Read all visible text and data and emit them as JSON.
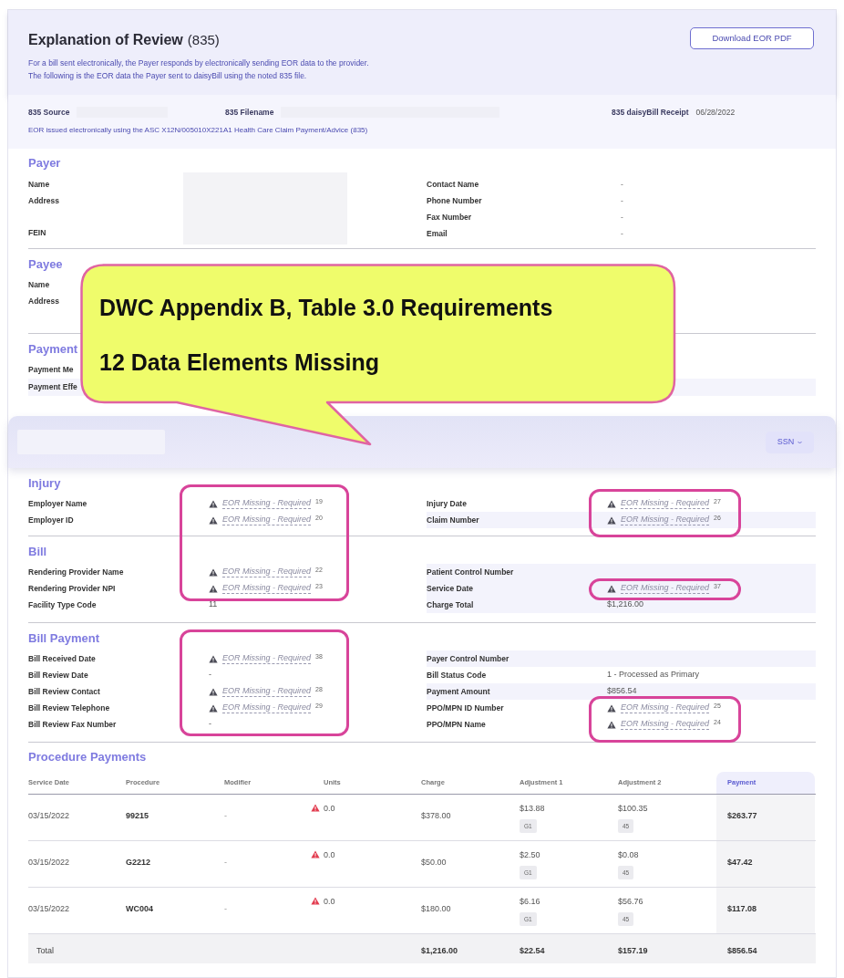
{
  "header": {
    "title": "Explanation of Review",
    "title_suffix": "(835)",
    "description": [
      "For a bill sent electronically, the Payer responds by electronically sending EOR data to the provider.",
      "The following is the EOR data the Payer sent to daisyBill using the noted 835 file."
    ],
    "button": "Download EOR PDF"
  },
  "source_bar": {
    "fields": [
      {
        "label": "835 Source",
        "kind": "redacted"
      },
      {
        "label": "835 Filename",
        "kind": "redacted"
      },
      {
        "label": "835 daisyBill Receipt",
        "kind": "text",
        "value": "06/28/2022"
      }
    ],
    "note": "EOR issued electronically using the ASC X12N/005010X221A1 Health Care Claim Payment/Advice (835)"
  },
  "payer": {
    "heading": "Payer",
    "left_labels": [
      "Name",
      "Address",
      "FEIN"
    ],
    "right": [
      {
        "label": "Contact Name",
        "value": "-"
      },
      {
        "label": "Phone Number",
        "value": "-"
      },
      {
        "label": "Fax Number",
        "value": "-"
      },
      {
        "label": "Email",
        "value": "-"
      }
    ]
  },
  "payee": {
    "heading": "Payee",
    "labels": [
      "Name",
      "Address"
    ]
  },
  "payment": {
    "heading": "Payment",
    "labels": [
      "Payment Me",
      "Payment Effe"
    ]
  },
  "callout": {
    "lines": [
      "DWC Appendix B, Table 3.0 Requirements",
      "12 Data Elements Missing"
    ]
  },
  "patient_bar": {
    "button": "SSN"
  },
  "sections": [
    {
      "heading": "Injury",
      "left": [
        {
          "label": "Employer Name",
          "kind": "missing",
          "value": "EOR Missing - Required",
          "ref": "19"
        },
        {
          "label": "Employer ID",
          "kind": "missing",
          "value": "EOR Missing - Required",
          "ref": "20"
        }
      ],
      "right": [
        {
          "label": "Injury Date",
          "kind": "missing",
          "value": "EOR Missing - Required",
          "ref": "27",
          "shaded": false
        },
        {
          "label": "Claim Number",
          "kind": "missing",
          "value": "EOR Missing - Required",
          "ref": "26",
          "shaded": true
        }
      ]
    },
    {
      "heading": "Bill",
      "left": [
        {
          "label": "Rendering Provider Name",
          "kind": "missing",
          "value": "EOR Missing - Required",
          "ref": "22"
        },
        {
          "label": "Rendering Provider NPI",
          "kind": "missing",
          "value": "EOR Missing - Required",
          "ref": "23"
        },
        {
          "label": "Facility Type Code",
          "kind": "text",
          "value": "11"
        }
      ],
      "right": [
        {
          "label": "Patient Control Number",
          "kind": "blank",
          "shaded": true
        },
        {
          "label": "Service Date",
          "kind": "missing",
          "value": "EOR Missing - Required",
          "ref": "37",
          "shaded": true
        },
        {
          "label": "Charge Total",
          "kind": "text",
          "value": "$1,216.00",
          "shaded": true
        }
      ]
    },
    {
      "heading": "Bill Payment",
      "left": [
        {
          "label": "Bill Received Date",
          "kind": "missing",
          "value": "EOR Missing - Required",
          "ref": "38"
        },
        {
          "label": "Bill Review Date",
          "kind": "text",
          "value": "-"
        },
        {
          "label": "Bill Review Contact",
          "kind": "missing",
          "value": "EOR Missing - Required",
          "ref": "28"
        },
        {
          "label": "Bill Review Telephone",
          "kind": "missing",
          "value": "EOR Missing - Required",
          "ref": "29"
        },
        {
          "label": "Bill Review Fax Number",
          "kind": "text",
          "value": "-"
        }
      ],
      "right": [
        {
          "label": "Payer Control Number",
          "kind": "blank",
          "shaded": true
        },
        {
          "label": "Bill Status Code",
          "kind": "text",
          "value": "1 - Processed as Primary",
          "shaded": false
        },
        {
          "label": "Payment Amount",
          "kind": "text",
          "value": "$856.54",
          "shaded": true
        },
        {
          "label": "PPO/MPN ID Number",
          "kind": "missing",
          "value": "EOR Missing - Required",
          "ref": "25",
          "shaded": false
        },
        {
          "label": "PPO/MPN Name",
          "kind": "missing",
          "value": "EOR Missing - Required",
          "ref": "24",
          "shaded": false
        }
      ]
    }
  ],
  "procedures": {
    "heading": "Procedure Payments",
    "columns": [
      "Service Date",
      "Procedure",
      "Modifier",
      "Units",
      "Charge",
      "Adjustment 1",
      "Adjustment 2",
      "Payment"
    ],
    "rows": [
      {
        "service_date": "03/15/2022",
        "procedure": "99215",
        "modifier": "-",
        "units": "0.0",
        "units_warning": true,
        "charge": "$378.00",
        "adjustment_1": {
          "amount": "$13.88",
          "code": "G1"
        },
        "adjustment_2": {
          "amount": "$100.35",
          "code": "45"
        },
        "payment": "$263.77"
      },
      {
        "service_date": "03/15/2022",
        "procedure": "G2212",
        "modifier": "-",
        "units": "0.0",
        "units_warning": true,
        "charge": "$50.00",
        "adjustment_1": {
          "amount": "$2.50",
          "code": "G1"
        },
        "adjustment_2": {
          "amount": "$0.08",
          "code": "45"
        },
        "payment": "$47.42"
      },
      {
        "service_date": "03/15/2022",
        "procedure": "WC004",
        "modifier": "-",
        "units": "0.0",
        "units_warning": true,
        "charge": "$180.00",
        "adjustment_1": {
          "amount": "$6.16",
          "code": "G1"
        },
        "adjustment_2": {
          "amount": "$56.76",
          "code": "45"
        },
        "payment": "$117.08"
      }
    ],
    "total": {
      "label": "Total",
      "charge": "$1,216.00",
      "adjustment_1": "$22.54",
      "adjustment_2": "$157.19",
      "payment": "$856.54"
    }
  }
}
